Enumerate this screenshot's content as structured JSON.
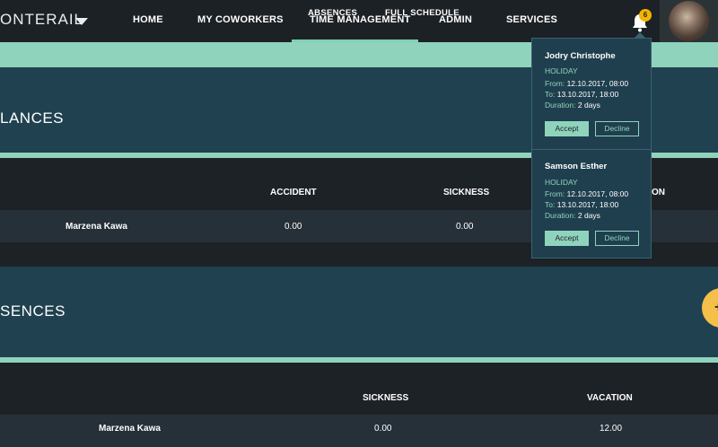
{
  "header": {
    "brand": "ONTERAIL",
    "nav": [
      "HOME",
      "MY COWORKERS",
      "TIME MANAGEMENT",
      "ADMIN",
      "SERVICES"
    ],
    "active_nav": "TIME MANAGEMENT",
    "notification_count": "6",
    "icons": {
      "bell": "bell-icon",
      "brand_menu": "caret-down-icon"
    }
  },
  "subnav": {
    "items": [
      "ABSENCES",
      "FULL SCHEDULE"
    ],
    "active": "ABSENCES"
  },
  "balances": {
    "title": "LANCES",
    "columns": [
      "ACCIDENT",
      "SICKNESS",
      "ON"
    ],
    "rows": [
      {
        "name": "Marzena Kawa",
        "accident": "0.00",
        "sickness": "0.00"
      }
    ]
  },
  "absences": {
    "title": "SENCES",
    "columns": [
      "SICKNESS",
      "VACATION"
    ],
    "rows": [
      {
        "name": "Marzena Kawa",
        "sickness": "0.00",
        "vacation": "12.00"
      }
    ]
  },
  "notifications": [
    {
      "name": "Jodry Christophe",
      "type": "HOLIDAY",
      "from_label": "From:",
      "from": "12.10.2017, 08:00",
      "to_label": "To:",
      "to": "13.10.2017, 18:00",
      "duration_label": "Duration:",
      "duration": "2 days",
      "accept": "Accept",
      "decline": "Decline"
    },
    {
      "name": "Samson Esther",
      "type": "HOLIDAY",
      "from_label": "From:",
      "from": "12.10.2017, 08:00",
      "to_label": "To:",
      "to": "13.10.2017, 18:00",
      "duration_label": "Duration:",
      "duration": "2 days",
      "accept": "Accept",
      "decline": "Decline"
    }
  ],
  "colors": {
    "accent": "#8fd3bc",
    "section": "#204150",
    "badge": "#f4b400",
    "fab": "#f4c04a"
  }
}
